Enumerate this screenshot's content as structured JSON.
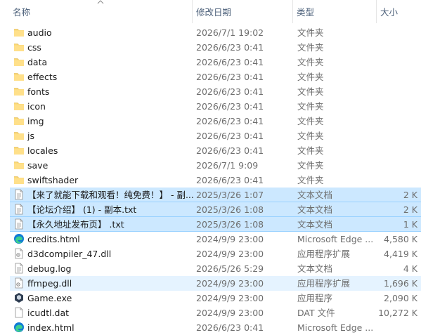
{
  "columns": {
    "name": "名称",
    "date": "修改日期",
    "type": "类型",
    "size": "大小"
  },
  "files": [
    {
      "name": "audio",
      "date": "2026/7/1 19:02",
      "type": "文件夹",
      "size": "",
      "icon": "folder-icon",
      "state": ""
    },
    {
      "name": "css",
      "date": "2026/6/23 0:41",
      "type": "文件夹",
      "size": "",
      "icon": "folder-icon",
      "state": ""
    },
    {
      "name": "data",
      "date": "2026/6/23 0:41",
      "type": "文件夹",
      "size": "",
      "icon": "folder-icon",
      "state": ""
    },
    {
      "name": "effects",
      "date": "2026/6/23 0:41",
      "type": "文件夹",
      "size": "",
      "icon": "folder-icon",
      "state": ""
    },
    {
      "name": "fonts",
      "date": "2026/6/23 0:41",
      "type": "文件夹",
      "size": "",
      "icon": "folder-icon",
      "state": ""
    },
    {
      "name": "icon",
      "date": "2026/6/23 0:41",
      "type": "文件夹",
      "size": "",
      "icon": "folder-icon",
      "state": ""
    },
    {
      "name": "img",
      "date": "2026/6/23 0:41",
      "type": "文件夹",
      "size": "",
      "icon": "folder-icon",
      "state": ""
    },
    {
      "name": "js",
      "date": "2026/6/23 0:41",
      "type": "文件夹",
      "size": "",
      "icon": "folder-icon",
      "state": ""
    },
    {
      "name": "locales",
      "date": "2026/6/23 0:41",
      "type": "文件夹",
      "size": "",
      "icon": "folder-icon",
      "state": ""
    },
    {
      "name": "save",
      "date": "2026/7/1 9:09",
      "type": "文件夹",
      "size": "",
      "icon": "folder-icon",
      "state": ""
    },
    {
      "name": "swiftshader",
      "date": "2026/6/23 0:41",
      "type": "文件夹",
      "size": "",
      "icon": "folder-icon",
      "state": ""
    },
    {
      "name": "【来了就能下载和观看！纯免费！】 - 副...",
      "date": "2025/3/26 1:07",
      "type": "文本文档",
      "size": "2 K",
      "icon": "text-file-icon",
      "state": "selected"
    },
    {
      "name": "【论坛介绍】 (1) - 副本.txt",
      "date": "2025/3/26 1:08",
      "type": "文本文档",
      "size": "2 K",
      "icon": "text-file-icon",
      "state": "selected"
    },
    {
      "name": "【永久地址发布页】 .txt",
      "date": "2025/3/26 1:08",
      "type": "文本文档",
      "size": "1 K",
      "icon": "text-file-icon",
      "state": "selected"
    },
    {
      "name": "credits.html",
      "date": "2024/9/9 23:00",
      "type": "Microsoft Edge ...",
      "size": "4,580 K",
      "icon": "edge-icon",
      "state": ""
    },
    {
      "name": "d3dcompiler_47.dll",
      "date": "2024/9/9 23:00",
      "type": "应用程序扩展",
      "size": "4,419 K",
      "icon": "dll-file-icon",
      "state": ""
    },
    {
      "name": "debug.log",
      "date": "2026/5/26 5:29",
      "type": "文本文档",
      "size": "4 K",
      "icon": "text-file-icon",
      "state": ""
    },
    {
      "name": "ffmpeg.dll",
      "date": "2024/9/9 23:00",
      "type": "应用程序扩展",
      "size": "1,696 K",
      "icon": "dll-file-icon",
      "state": "hover"
    },
    {
      "name": "Game.exe",
      "date": "2024/9/9 23:00",
      "type": "应用程序",
      "size": "2,090 K",
      "icon": "game-exe-icon",
      "state": ""
    },
    {
      "name": "icudtl.dat",
      "date": "2024/9/9 23:00",
      "type": "DAT 文件",
      "size": "10,272 K",
      "icon": "blank-file-icon",
      "state": ""
    },
    {
      "name": "index.html",
      "date": "2026/6/23 0:41",
      "type": "Microsoft Edge ...",
      "size": "",
      "icon": "edge-icon",
      "state": ""
    }
  ]
}
